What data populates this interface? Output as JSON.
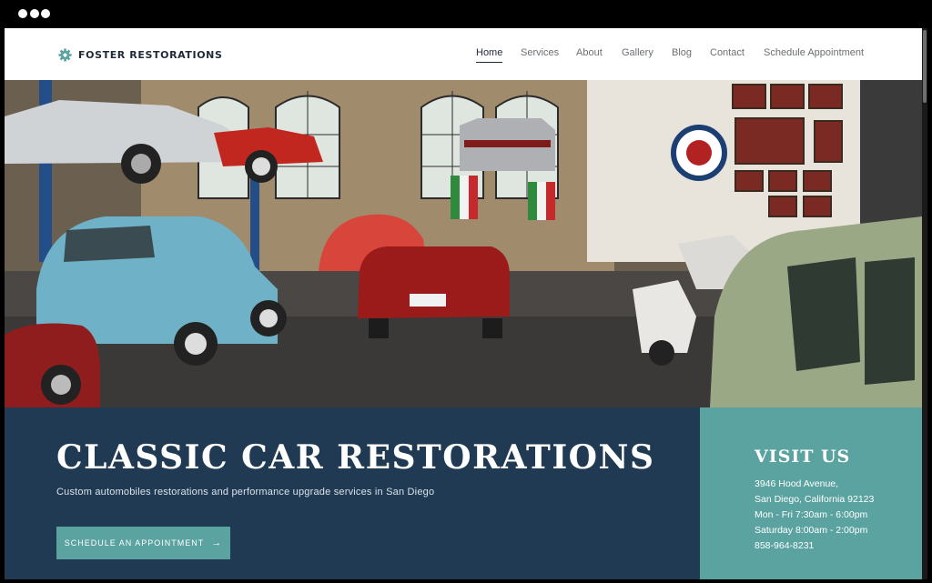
{
  "site": {
    "brand": "FOSTER RESTORATIONS",
    "logo_icon": "gear-icon",
    "accent_color": "#5aa3a0",
    "dark_color": "#1f3a52"
  },
  "nav": {
    "items": [
      {
        "label": "Home",
        "active": true
      },
      {
        "label": "Services",
        "active": false
      },
      {
        "label": "About",
        "active": false
      },
      {
        "label": "Gallery",
        "active": false
      },
      {
        "label": "Blog",
        "active": false
      },
      {
        "label": "Contact",
        "active": false
      },
      {
        "label": "Schedule Appointment",
        "active": false
      }
    ]
  },
  "hero": {
    "title": "CLASSIC CAR RESTORATIONS",
    "subtitle": "Custom automobiles restorations and performance upgrade services in San Diego",
    "cta_label": "SCHEDULE AN APPOINTMENT",
    "cta_icon": "arrow-right-icon"
  },
  "visit": {
    "title": "VISIT US",
    "lines": [
      "3946 Hood Avenue,",
      "San Diego, California 92123",
      "Mon - Fri 7:30am - 6:00pm",
      "Saturday 8:00am - 2:00pm",
      "858-964-8231"
    ]
  }
}
